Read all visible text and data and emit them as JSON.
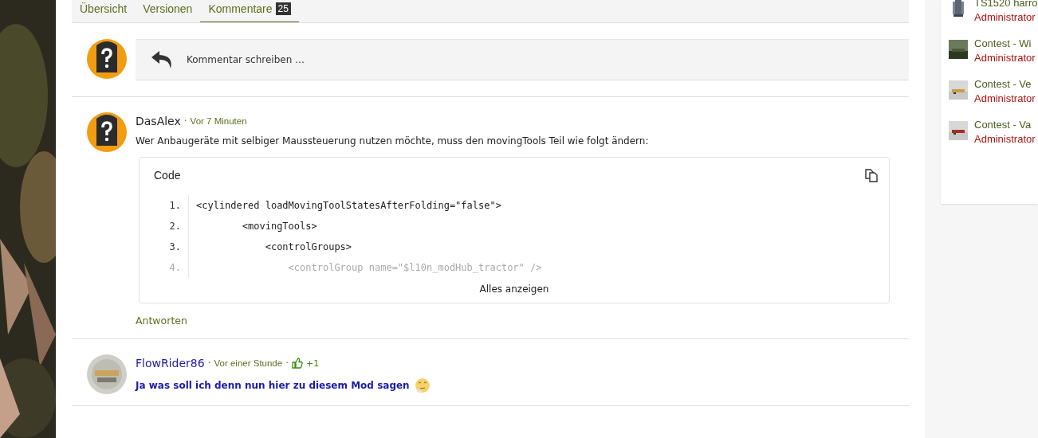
{
  "tabs": [
    {
      "label": "Übersicht",
      "selected": false
    },
    {
      "label": "Versionen",
      "selected": false
    },
    {
      "label": "Kommentare",
      "badge": "25",
      "selected": true
    }
  ],
  "compose": {
    "placeholder": "Kommentar schreiben …"
  },
  "comments": [
    {
      "kind": "code",
      "author": "DasAlex",
      "author_highlighted": false,
      "separators": [
        "·"
      ],
      "time": "Vor 7 Minuten",
      "text": "Wer Anbaugeräte mit selbiger Maussteuerung nutzen möchte, muss den movingTools Teil wie folgt ändern:",
      "emphasis": false,
      "code": {
        "title": "Code",
        "lines": [
          {
            "number": "1.",
            "text": "<cylindered loadMovingToolStatesAfterFolding=\"false\">",
            "faded": false
          },
          {
            "number": "2.",
            "text": "        <movingTools>",
            "faded": false
          },
          {
            "number": "3.",
            "text": "            <controlGroups>",
            "faded": false
          },
          {
            "number": "4.",
            "text": "                <controlGroup name=\"$l10n_modHub_tractor\" />",
            "faded": true
          }
        ],
        "expand": "Alles anzeigen"
      },
      "reply": "Antworten"
    },
    {
      "kind": "text",
      "author": "FlowRider86",
      "author_highlighted": true,
      "separators": [
        "·",
        "·"
      ],
      "time": "Vor einer Stunde",
      "likes": "+1",
      "text": "Ja was soll ich denn nun hier zu diesem Mod sagen",
      "emphasis": true
    }
  ],
  "sidebar": {
    "items": [
      {
        "title": "TS1520 harro",
        "author": "Administrator"
      },
      {
        "title": "Contest - Wi",
        "author": "Administrator"
      },
      {
        "title": "Contest - Ve",
        "author": "Administrator"
      },
      {
        "title": "Contest - Va",
        "author": "Administrator"
      }
    ]
  }
}
